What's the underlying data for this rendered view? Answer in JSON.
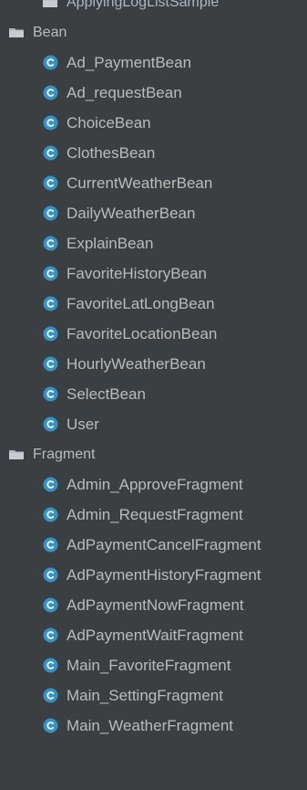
{
  "tree": {
    "top_partial": {
      "label": "ApplyingLogListSample",
      "kind": "folder"
    },
    "groups": [
      {
        "label": "Bean",
        "children": [
          "Ad_PaymentBean",
          "Ad_requestBean",
          "ChoiceBean",
          "ClothesBean",
          "CurrentWeatherBean",
          "DailyWeatherBean",
          "ExplainBean",
          "FavoriteHistoryBean",
          "FavoriteLatLongBean",
          "FavoriteLocationBean",
          "HourlyWeatherBean",
          "SelectBean",
          "User"
        ]
      },
      {
        "label": "Fragment",
        "children": [
          "Admin_ApproveFragment",
          "Admin_RequestFragment",
          "AdPaymentCancelFragment",
          "AdPaymentHistoryFragment",
          "AdPaymentNowFragment",
          "AdPaymentWaitFragment",
          "Main_FavoriteFragment",
          "Main_SettingFragment",
          "Main_WeatherFragment"
        ]
      }
    ]
  },
  "icons": {
    "folder": "folder-icon",
    "class": "class-icon"
  },
  "colors": {
    "background": "#3c3f41",
    "text": "#bbbbbb",
    "class_icon_fill": "#3592c4",
    "class_icon_letter": "#e8f3fb",
    "folder_icon": "#bfc7cf"
  }
}
